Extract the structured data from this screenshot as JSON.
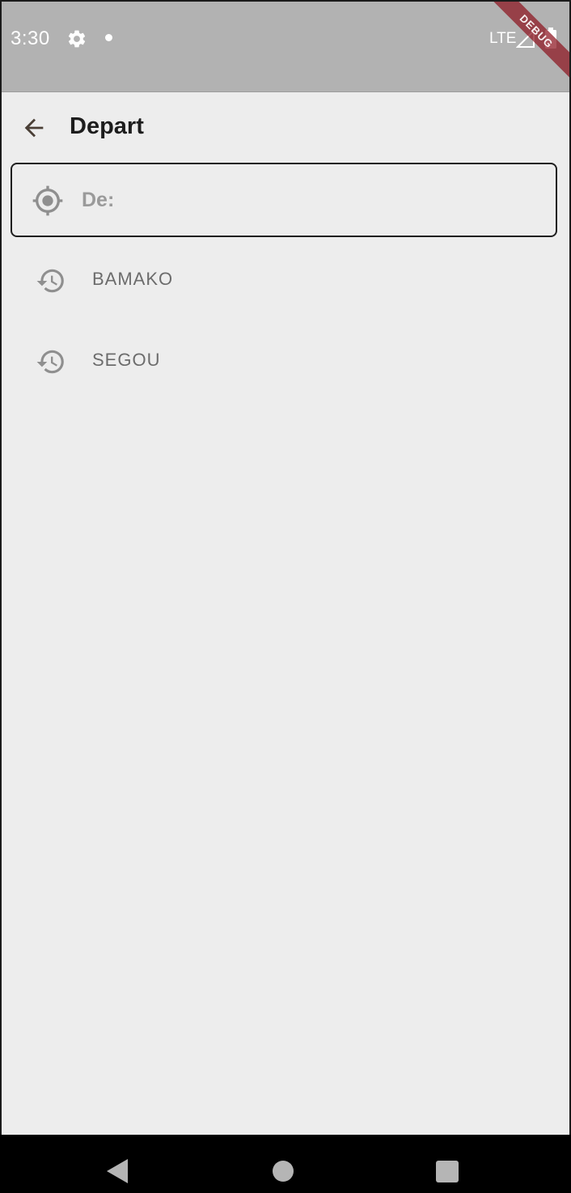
{
  "status_bar": {
    "time": "3:30",
    "network": "LTE",
    "icons": [
      "gear-icon",
      "notification-dot-icon",
      "signal-icon",
      "battery-icon"
    ],
    "background": "#b2b2b2"
  },
  "debug_banner": "DEBUG",
  "app_bar": {
    "title": "Depart",
    "back_icon": "arrow-back-icon"
  },
  "search": {
    "placeholder": "De:",
    "value": "",
    "icon": "my-location-icon"
  },
  "history": {
    "icon": "history-icon",
    "items": [
      {
        "label": "BAMAKO"
      },
      {
        "label": "SEGOU"
      }
    ]
  },
  "nav_bar": {
    "icons": [
      "nav-back-icon",
      "nav-home-icon",
      "nav-recents-icon"
    ]
  },
  "colors": {
    "background": "#ededed",
    "text_dark": "#1d1d1d",
    "text_muted": "#6c6c6c",
    "icon_muted": "#8f8f8f",
    "debug_banner": "#8c141e"
  }
}
